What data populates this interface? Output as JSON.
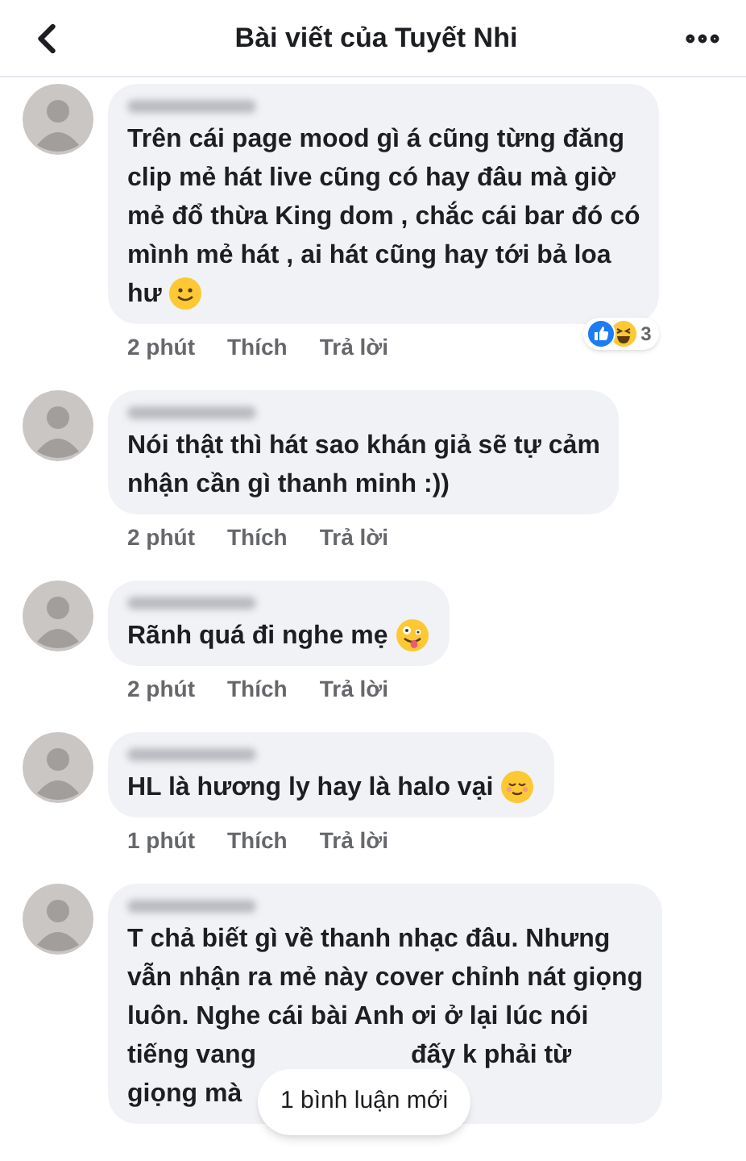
{
  "header": {
    "title": "Bài viết của Tuyết Nhi"
  },
  "comments": [
    {
      "lines": [
        [
          "Trên cái page mood gì á cũng từng đăng"
        ],
        [
          "clip mẻ hát live cũng có hay đâu mà giờ"
        ],
        [
          "mẻ đổ thừa King dom , chắc cái bar đó có"
        ],
        [
          "mình mẻ hát , ai hát cũng hay tới bả loa"
        ],
        [
          "hư"
        ]
      ],
      "end_icon": {
        "kind": "smile"
      },
      "time": "2 phút",
      "like": "Thích",
      "reply": "Trả lời",
      "reactions": {
        "icons": [
          {
            "kind": "like"
          },
          {
            "kind": "haha"
          }
        ],
        "count": "3"
      }
    },
    {
      "lines": [
        [
          "Nói thật thì hát sao khán giả sẽ tự cảm"
        ],
        [
          "nhận cần gì thanh minh :))"
        ]
      ],
      "time": "2 phút",
      "like": "Thích",
      "reply": "Trả lời"
    },
    {
      "lines": [
        [
          "Rãnh quá đi nghe mẹ"
        ]
      ],
      "end_icon": {
        "kind": "zany"
      },
      "time": "2 phút",
      "like": "Thích",
      "reply": "Trả lời"
    },
    {
      "lines": [
        [
          "HL là hương ly hay là halo vại"
        ]
      ],
      "end_icon": {
        "kind": "relieved"
      },
      "time": "1 phút",
      "like": "Thích",
      "reply": "Trả lời"
    },
    {
      "lines": [
        [
          "T chả biết gì về thanh nhạc đâu. Nhưng"
        ],
        [
          "vẫn nhận ra mẻ này cover chỉnh nát giọng"
        ],
        [
          "luôn. Nghe cái bài Anh ơi ở lại lúc nói"
        ],
        [
          "tiếng vang",
          "đấy k phải từ"
        ],
        [
          "giọng mà"
        ]
      ]
    }
  ],
  "new_comments_pill": "1 bình luận mới"
}
